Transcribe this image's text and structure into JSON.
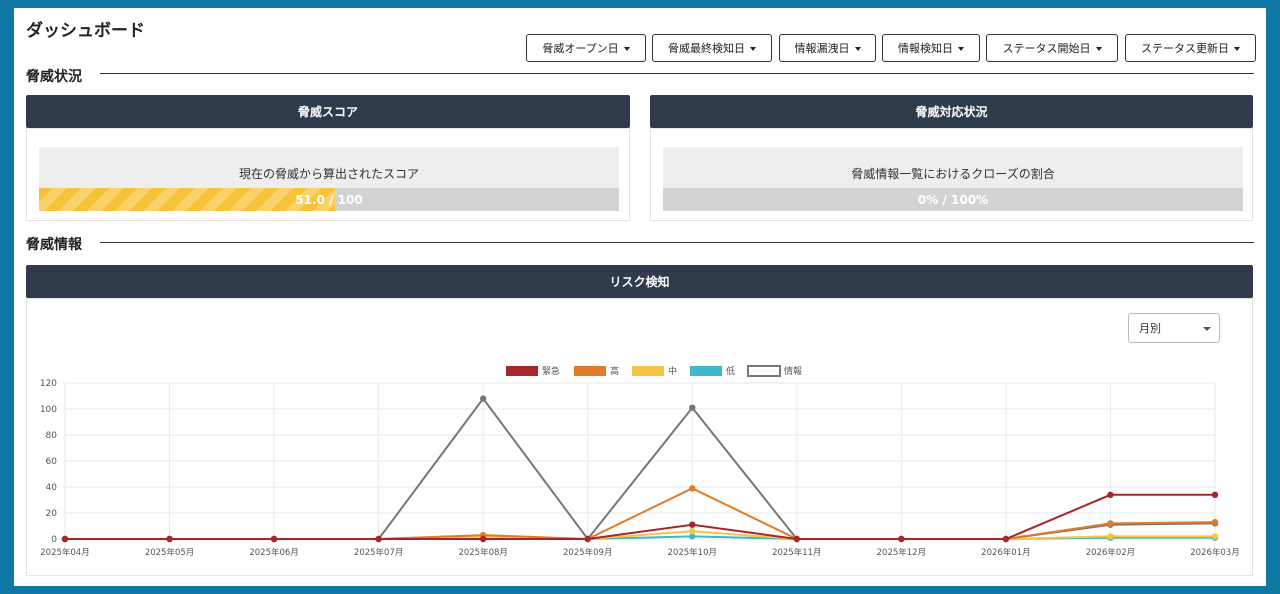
{
  "title": "ダッシュボード",
  "filters": [
    "脅威オープン日",
    "脅威最終検知日",
    "情報漏洩日",
    "情報検知日",
    "ステータス開始日",
    "ステータス更新日"
  ],
  "sections": {
    "threat_status": "脅威状況",
    "threat_info": "脅威情報"
  },
  "score_card": {
    "header": "脅威スコア",
    "label": "現在の脅威から算出されたスコア",
    "value_text": "51.0 / 100",
    "progress": 0.51
  },
  "response_card": {
    "header": "脅威対応状況",
    "label": "脅威情報一覧におけるクローズの割合",
    "value_text": "0% / 100%",
    "progress": 0
  },
  "risk": {
    "header": "リスク検知",
    "period_select": "月別"
  },
  "chart_data": {
    "type": "line",
    "x": [
      "2025年04月",
      "2025年05月",
      "2025年06月",
      "2025年07月",
      "2025年08月",
      "2025年09月",
      "2025年10月",
      "2025年11月",
      "2025年12月",
      "2026年01月",
      "2026年02月",
      "2026年03月"
    ],
    "ylim": [
      0,
      120
    ],
    "yticks": [
      0,
      20,
      40,
      60,
      80,
      100,
      120
    ],
    "legend_position": "top-center",
    "grid": true,
    "series": [
      {
        "name": "情報",
        "color": "#777777",
        "values": [
          0,
          0,
          0,
          0,
          108,
          0,
          101,
          0,
          0,
          0,
          11,
          12
        ]
      },
      {
        "name": "低",
        "color": "#3fb8cc",
        "values": [
          0,
          0,
          0,
          0,
          0,
          0,
          2,
          0,
          0,
          0,
          1,
          1
        ]
      },
      {
        "name": "中",
        "color": "#f4c542",
        "values": [
          0,
          0,
          0,
          0,
          2,
          0,
          6,
          0,
          0,
          0,
          2,
          2
        ]
      },
      {
        "name": "高",
        "color": "#e07b28",
        "values": [
          0,
          0,
          0,
          0,
          3,
          0,
          39,
          0,
          0,
          0,
          12,
          13
        ]
      },
      {
        "name": "緊急",
        "color": "#a8262b",
        "values": [
          0,
          0,
          0,
          0,
          0,
          0,
          11,
          0,
          0,
          0,
          34,
          34
        ]
      }
    ]
  }
}
